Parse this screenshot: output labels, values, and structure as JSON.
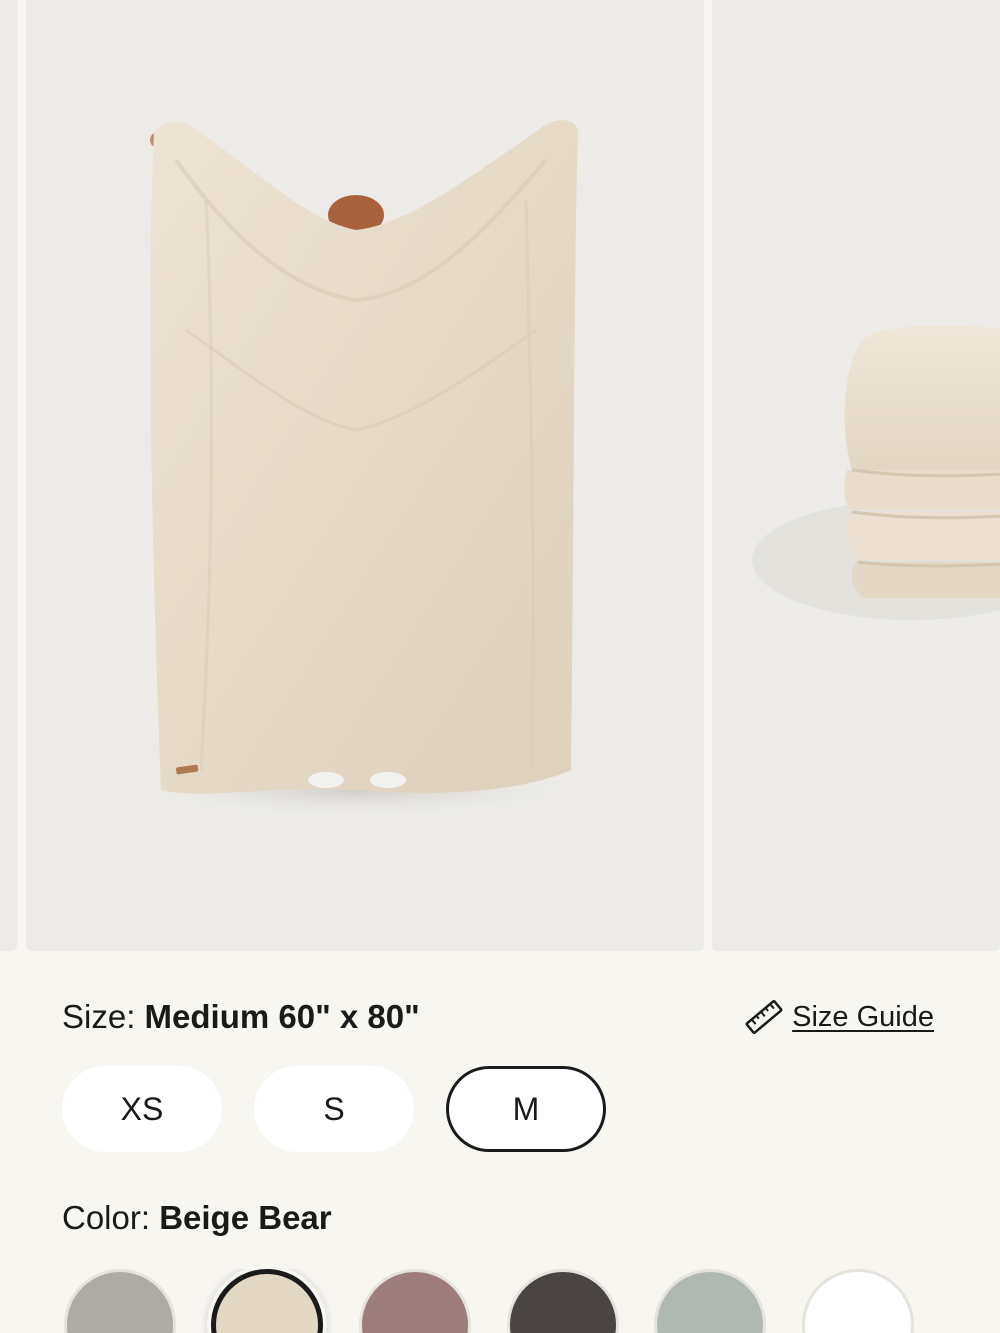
{
  "size": {
    "label": "Size:",
    "value": "Medium 60\" x 80\"",
    "guide_label": "Size Guide",
    "options": [
      {
        "label": "XS",
        "selected": false
      },
      {
        "label": "S",
        "selected": false
      },
      {
        "label": "M",
        "selected": true
      }
    ]
  },
  "color": {
    "label": "Color:",
    "value": "Beige Bear",
    "swatches": [
      {
        "color": "#aeaba4",
        "selected": false
      },
      {
        "color": "#e3d7c6",
        "selected": true
      },
      {
        "color": "#9d7d7c",
        "selected": false
      },
      {
        "color": "#4a4442",
        "selected": false
      },
      {
        "color": "#b0b8b4",
        "selected": false
      },
      {
        "color": "#ffffff",
        "selected": false
      }
    ]
  },
  "gallery": {
    "background": "#ecebe7",
    "blanket_color": "#e9dece"
  }
}
